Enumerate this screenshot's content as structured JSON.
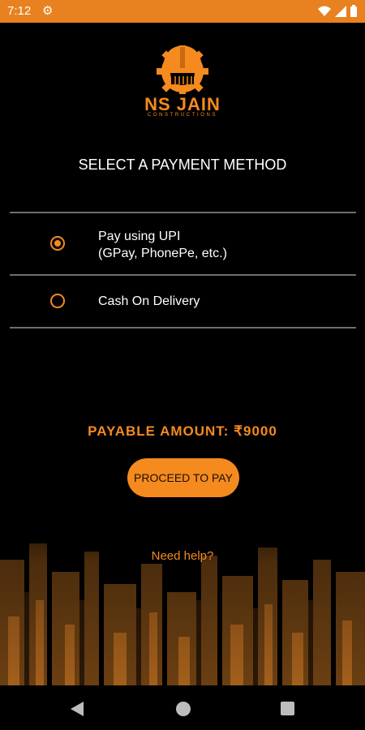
{
  "status_bar": {
    "time": "7:12",
    "icons": [
      "gear-icon",
      "wifi-icon",
      "signal-icon",
      "battery-icon"
    ]
  },
  "brand": {
    "name": "NS JAIN",
    "tagline": "CONSTRUCTIONS"
  },
  "page": {
    "title": "SELECT A PAYMENT METHOD"
  },
  "payment_options": [
    {
      "line1": "Pay using UPI",
      "line2": "(GPay, PhonePe, etc.)",
      "selected": true
    },
    {
      "line1": "Cash On Delivery",
      "line2": "",
      "selected": false
    }
  ],
  "payment": {
    "payable_label": "PAYABLE AMOUNT: ₹9000",
    "proceed_label": "PROCEED TO PAY",
    "help_label": "Need help?"
  },
  "colors": {
    "accent": "#f58a1f",
    "status_bar": "#e8811f",
    "background": "#000000",
    "divider": "#6e6e6e"
  },
  "nav_bar": {
    "icons": [
      "back-icon",
      "home-icon",
      "recents-icon"
    ]
  }
}
